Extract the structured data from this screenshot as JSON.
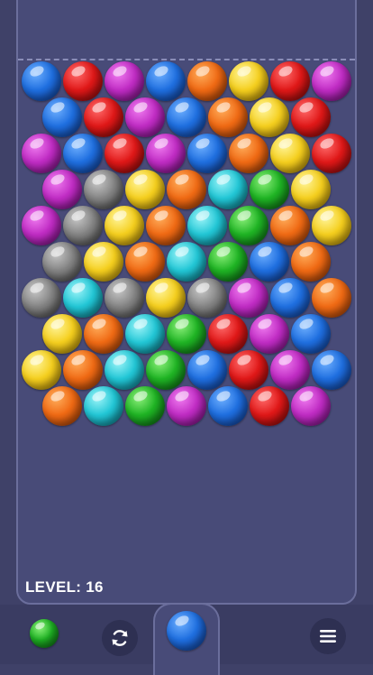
{
  "level": {
    "text": "LEVEL: 16"
  },
  "colors": {
    "blue": "#1f6fe0",
    "red": "#e01818",
    "purple": "#c02cc4",
    "orange": "#f06a14",
    "yellow": "#f5cf1e",
    "gray": "#848484",
    "cyan": "#22c7d6",
    "green": "#1fb424"
  },
  "grid_rows": [
    [
      "blue",
      "red",
      "purple",
      "blue",
      "orange",
      "yellow",
      "red",
      "purple"
    ],
    [
      "blue",
      "red",
      "purple",
      "blue",
      "orange",
      "yellow",
      "red"
    ],
    [
      "purple",
      "blue",
      "red",
      "purple",
      "blue",
      "orange",
      "yellow",
      "red"
    ],
    [
      "purple",
      "gray",
      "yellow",
      "orange",
      "cyan",
      "green",
      "yellow"
    ],
    [
      "purple",
      "gray",
      "yellow",
      "orange",
      "cyan",
      "green",
      "orange",
      "yellow"
    ],
    [
      "gray",
      "yellow",
      "orange",
      "cyan",
      "green",
      "blue",
      "orange"
    ],
    [
      "gray",
      "cyan",
      "gray",
      "yellow",
      "gray",
      "purple",
      "blue",
      "orange"
    ],
    [
      "yellow",
      "orange",
      "cyan",
      "green",
      "red",
      "purple",
      "blue"
    ],
    [
      "yellow",
      "orange",
      "cyan",
      "green",
      "blue",
      "red",
      "purple",
      "blue"
    ],
    [
      "orange",
      "cyan",
      "green",
      "purple",
      "blue",
      "red",
      "purple"
    ]
  ],
  "shooter": {
    "color": "blue"
  },
  "next": {
    "color": "green"
  },
  "icons": {
    "swap": "refresh-icon",
    "menu": "hamburger-menu-icon"
  }
}
